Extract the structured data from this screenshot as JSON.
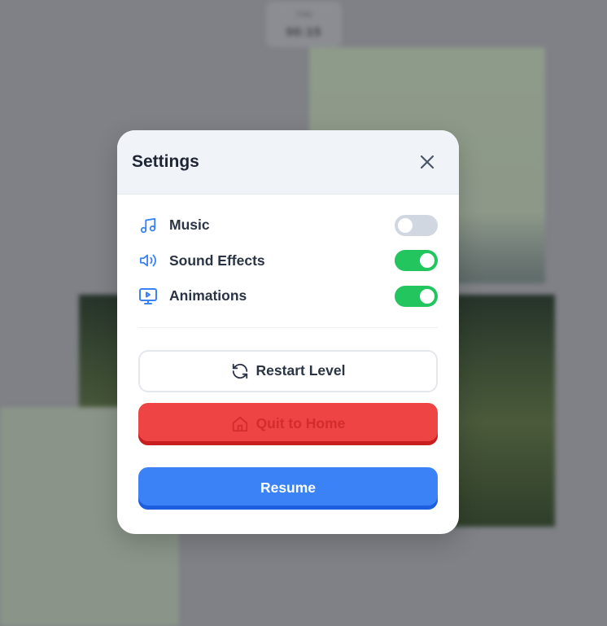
{
  "background": {
    "timer_label": "TIME",
    "timer_value": "00:15"
  },
  "settings_modal": {
    "title": "Settings",
    "close_icon": "close-icon",
    "toggles": [
      {
        "label": "Music",
        "icon": "music-note-icon",
        "enabled": false
      },
      {
        "label": "Sound Effects",
        "icon": "speaker-icon",
        "enabled": true
      },
      {
        "label": "Animations",
        "icon": "monitor-play-icon",
        "enabled": true
      }
    ],
    "buttons": {
      "restart": {
        "label": "Restart Level",
        "icon": "refresh-icon"
      },
      "quit": {
        "label": "Quit to Home",
        "icon": "home-icon"
      },
      "resume": {
        "label": "Resume"
      }
    }
  },
  "colors": {
    "toggle_on": "#22c55e",
    "toggle_off": "#d1d7e0",
    "accent_blue": "#3b82f6",
    "danger_red": "#ef4444"
  }
}
